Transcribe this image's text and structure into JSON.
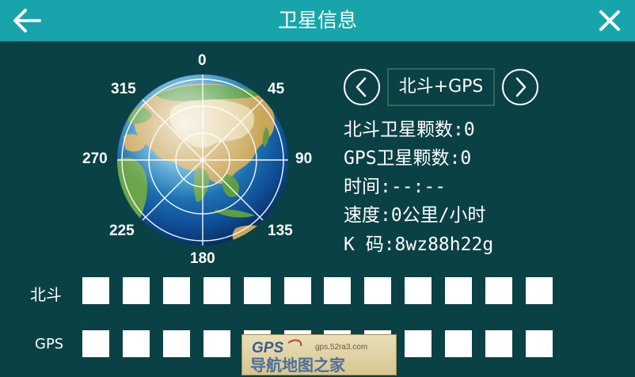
{
  "header": {
    "title": "卫星信息",
    "back_icon": "arrow-left-icon",
    "close_icon": "close-icon"
  },
  "colors": {
    "titlebar": "#17a5ab",
    "background": "#0a4145",
    "box": "#ffffff"
  },
  "compass": {
    "deg_0": "0",
    "deg_45": "45",
    "deg_90": "90",
    "deg_135": "135",
    "deg_180": "180",
    "deg_225": "225",
    "deg_270": "270",
    "deg_315": "315"
  },
  "mode": {
    "label": "北斗+GPS",
    "prev_icon": "chevron-left-icon",
    "next_icon": "chevron-right-icon"
  },
  "info": {
    "beidou_count": "北斗卫星颗数:0",
    "gps_count": "GPS卫星颗数:0",
    "time": "时间:--:--",
    "speed": "速度:0公里/小时",
    "k_code": "K 码:8wz88h22g"
  },
  "rows": {
    "beidou_label": "北斗",
    "gps_label": "GPS",
    "box_count": 12
  },
  "watermark": {
    "logo": "GPS",
    "site": "gps.52ra3.com",
    "name": "导航地图之家"
  }
}
